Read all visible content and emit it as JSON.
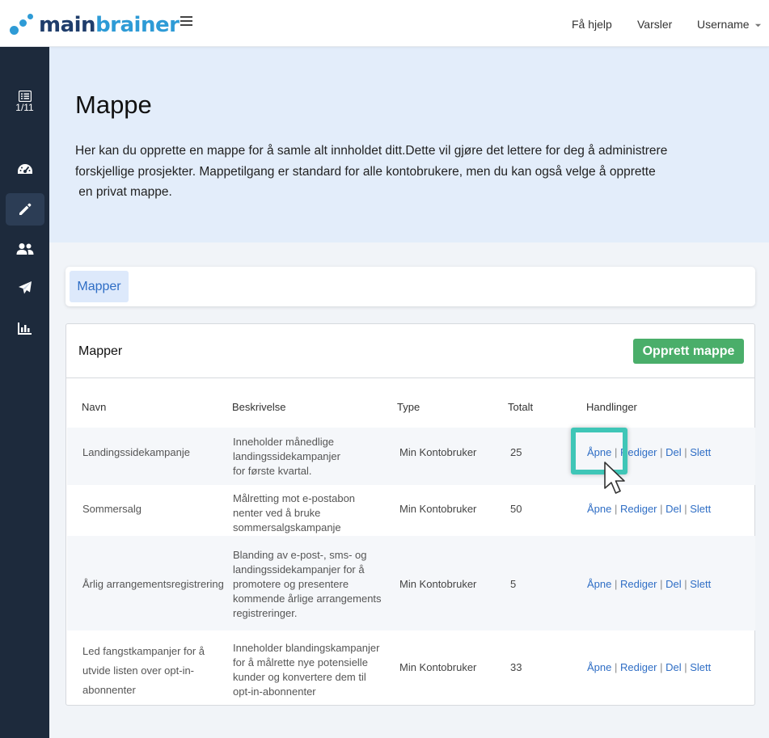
{
  "brand": {
    "part1": "main",
    "part2": "brainer"
  },
  "topnav": {
    "help": "Få hjelp",
    "alerts": "Varsler",
    "user": "Username"
  },
  "sidebar": {
    "counter": "1/11",
    "items": [
      {
        "icon": "list-icon"
      },
      {
        "icon": "dashboard-icon"
      },
      {
        "icon": "pencil-icon",
        "active": true
      },
      {
        "icon": "users-icon"
      },
      {
        "icon": "paper-plane-icon"
      },
      {
        "icon": "bar-chart-icon"
      }
    ]
  },
  "hero": {
    "title": "Mappe",
    "line1": "Her kan du opprette en mappe for å samle alt innholdet ditt.Dette vil gjøre det lettere for deg å administrere",
    "line2": "forskjellige prosjekter. Mappetilgang er standard for alle kontobrukere, men du kan også velge å opprette",
    "line3": " en privat mappe."
  },
  "tabs": {
    "active": "Mapper"
  },
  "card": {
    "title": "Mapper",
    "create_button": "Opprett mappe",
    "headers": {
      "name": "Navn",
      "description": "Beskrivelse",
      "type": "Type",
      "total": "Totalt",
      "actions": "Handlinger"
    },
    "action_labels": {
      "open": "Åpne",
      "edit": "Rediger",
      "share": "Del",
      "delete": "Slett",
      "sep": " | "
    },
    "rows": [
      {
        "name_lines": [
          "Landingssidekampanje"
        ],
        "desc_lines": [
          "Inneholder månedlige",
          "landingssidekampanjer",
          "for første kvartal."
        ],
        "type": "Min Kontobruker",
        "total": "25"
      },
      {
        "name_lines": [
          "Sommersalg"
        ],
        "desc_lines": [
          "Målretting mot e-postabon",
          "nenter ved å bruke",
          "sommersalgskampanje"
        ],
        "type": "Min Kontobruker",
        "total": "50"
      },
      {
        "name_lines": [
          "Årlig arrangementsregistrering"
        ],
        "desc_lines": [
          "Blanding av e-post-, sms- og",
          "landingssidekampanjer for å",
          "promotere og presentere",
          "kommende årlige arrangements",
          "registreringer."
        ],
        "type": "Min Kontobruker",
        "total": "5"
      },
      {
        "name_lines": [
          "Led fangstkampanjer for å",
          "utvide listen over opt-in-",
          "abonnenter"
        ],
        "desc_lines": [
          "Inneholder blandingskampanjer",
          "for å målrette nye potensielle",
          "kunder og konvertere dem til",
          "opt-in-abonnenter"
        ],
        "type": "Min Kontobruker",
        "total": "33"
      }
    ]
  },
  "colors": {
    "sidebar": "#1d2a3c",
    "hero": "#e3edfa",
    "accent": "#2f6ec5",
    "create": "#4aae6a",
    "highlight": "#3fc6b7"
  }
}
